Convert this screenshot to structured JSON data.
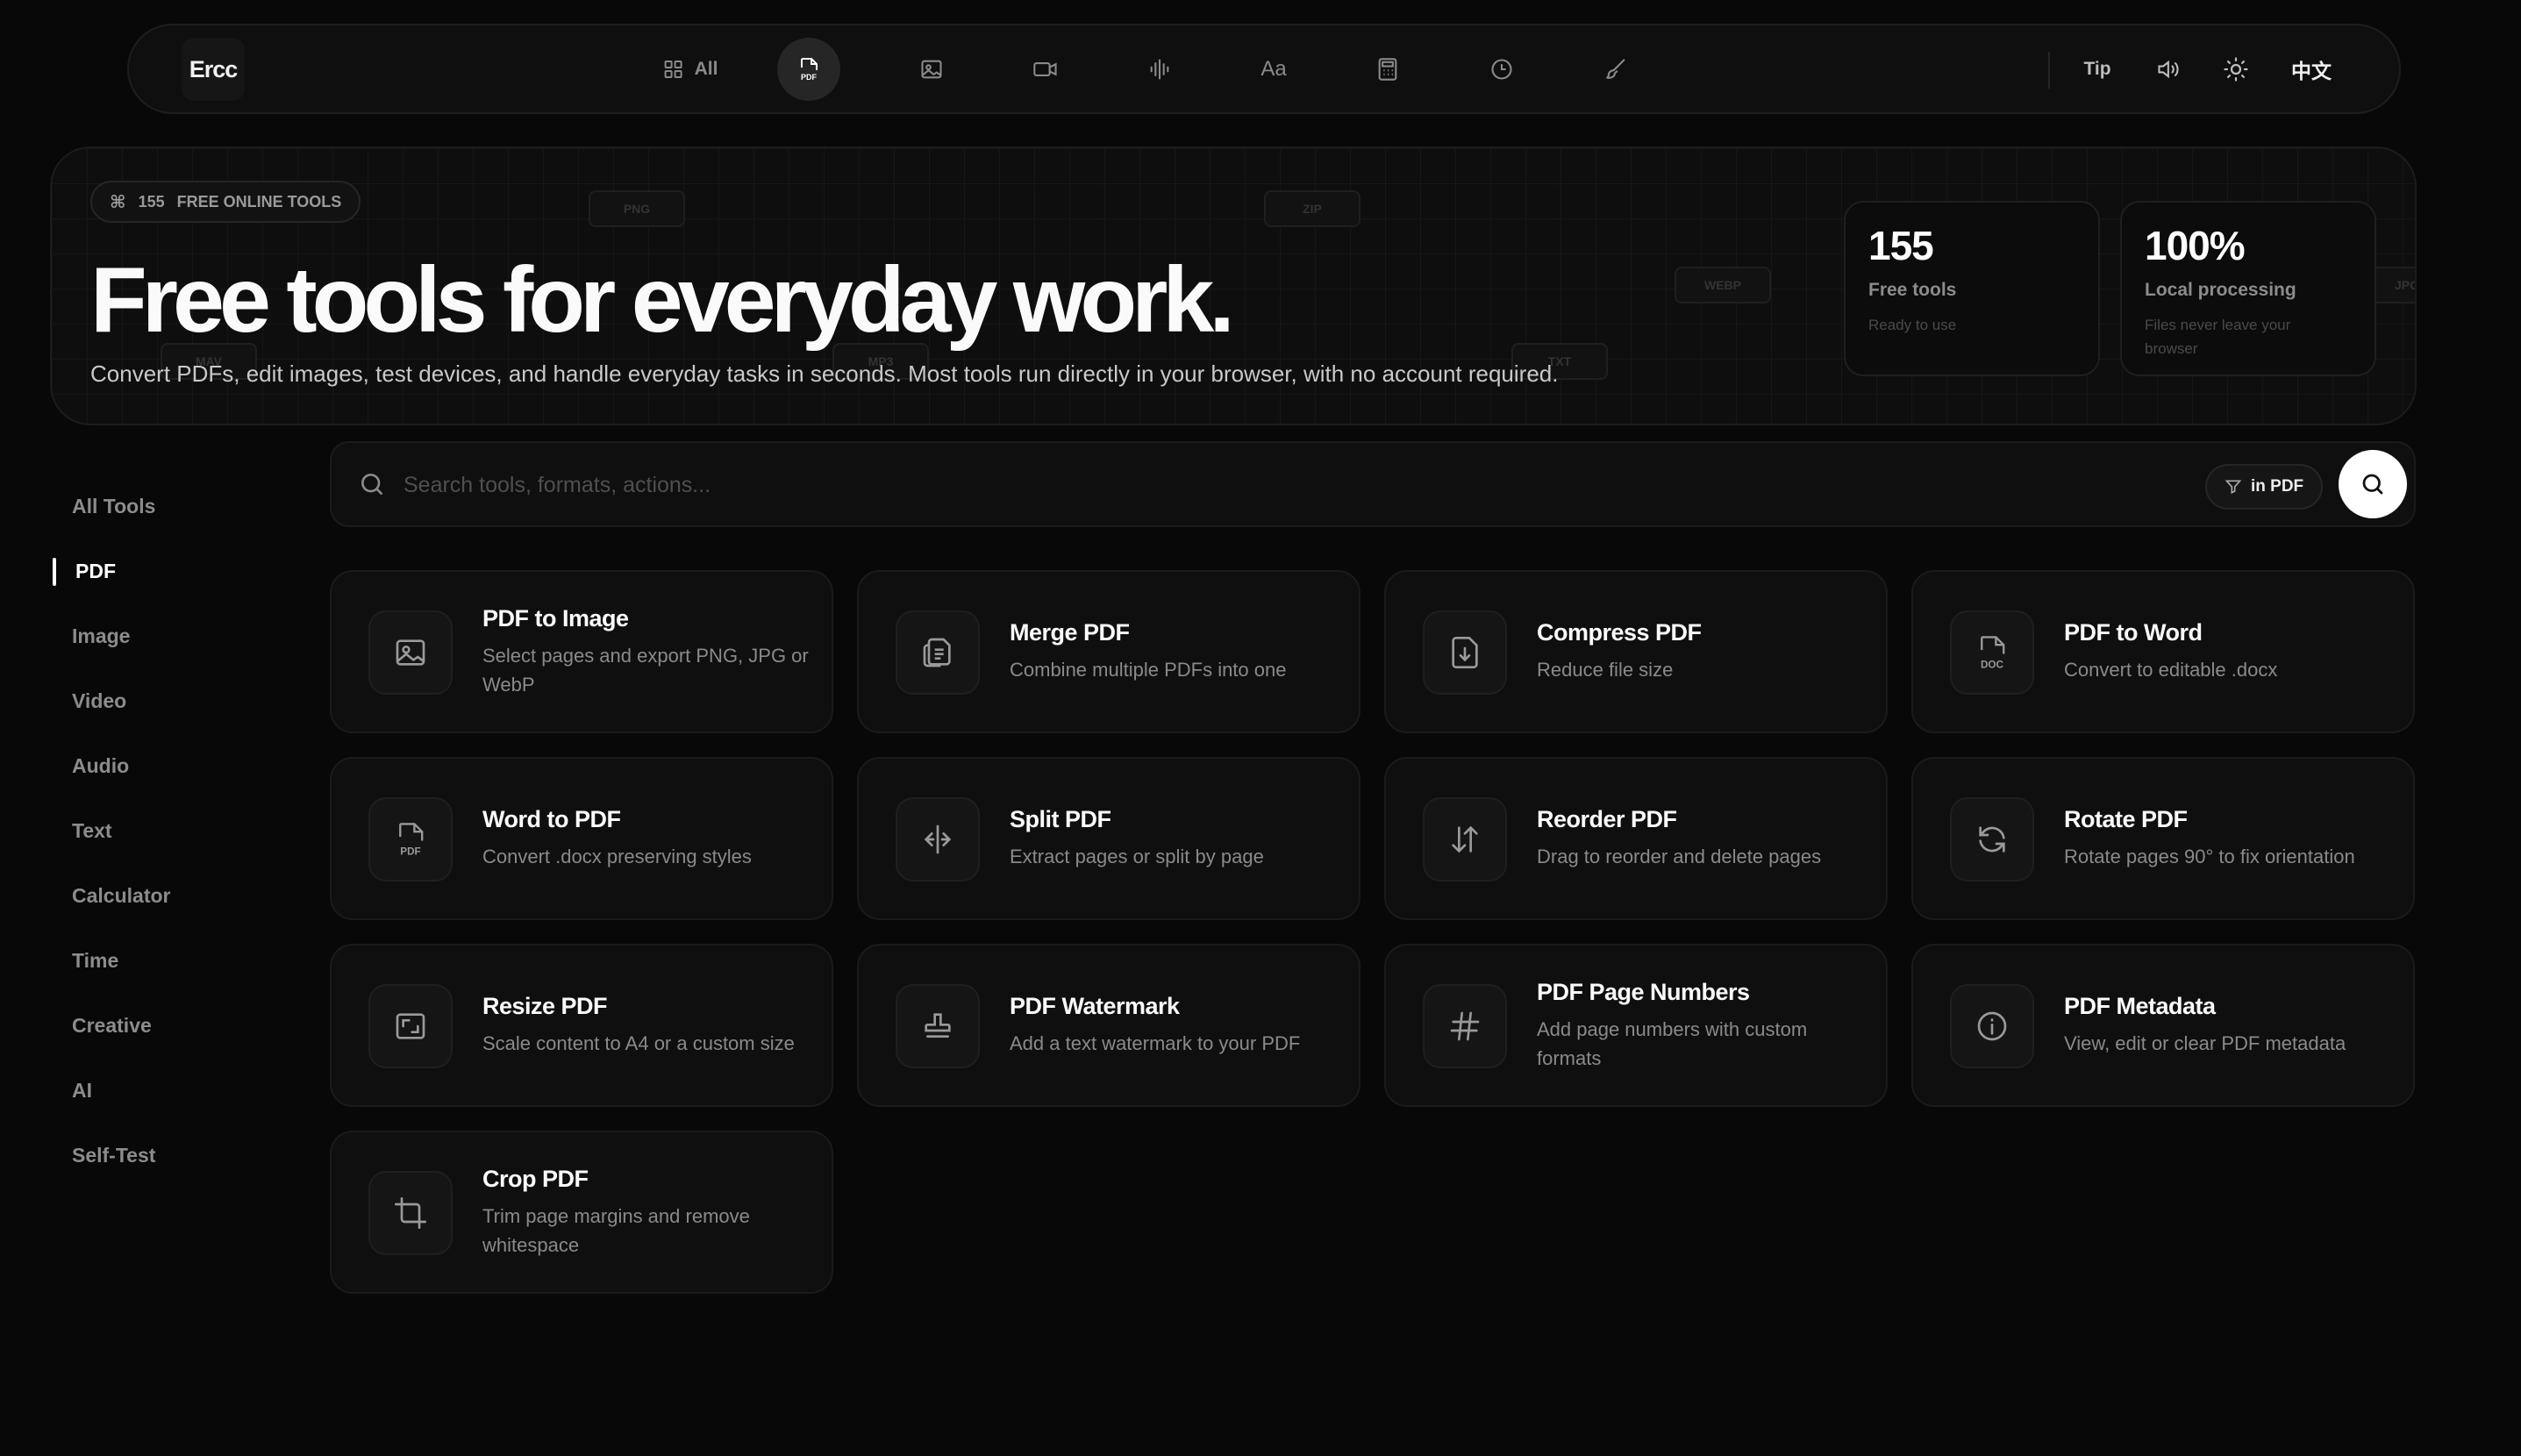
{
  "nav": {
    "brand": "Ercc",
    "all_label": "All",
    "pdf_icon_label": "PDF",
    "tip_label": "Tip",
    "lang_label": "中文"
  },
  "hero": {
    "badge_count": "155",
    "badge_label": "FREE ONLINE TOOLS",
    "title": "Free tools for everyday work.",
    "subtitle": "Convert PDFs, edit images, test devices, and handle everyday tasks in seconds. Most tools run directly in your browser, with no account required.",
    "ghost_chips": [
      "PNG",
      "ZIP",
      "WEBP",
      "JPG",
      "MAV",
      "MP3",
      "TXT"
    ],
    "stats": [
      {
        "value": "155",
        "label": "Free tools",
        "note": "Ready to use"
      },
      {
        "value": "100%",
        "label": "Local processing",
        "note": "Files never leave your browser"
      }
    ]
  },
  "sidebar": {
    "items": [
      {
        "label": "All Tools"
      },
      {
        "label": "PDF"
      },
      {
        "label": "Image"
      },
      {
        "label": "Video"
      },
      {
        "label": "Audio"
      },
      {
        "label": "Text"
      },
      {
        "label": "Calculator"
      },
      {
        "label": "Time"
      },
      {
        "label": "Creative"
      },
      {
        "label": "AI"
      },
      {
        "label": "Self-Test"
      }
    ],
    "active": "PDF"
  },
  "search": {
    "placeholder": "Search tools, formats, actions...",
    "value": "",
    "filter_label": "in PDF"
  },
  "tools": [
    {
      "title": "PDF to Image",
      "desc": "Select pages and export PNG, JPG or WebP",
      "icon": "image-icon"
    },
    {
      "title": "Merge PDF",
      "desc": "Combine multiple PDFs into one",
      "icon": "merge-files-icon"
    },
    {
      "title": "Compress PDF",
      "desc": "Reduce file size",
      "icon": "file-download-icon"
    },
    {
      "title": "PDF to Word",
      "desc": "Convert to editable .docx",
      "icon": "doc-file-icon",
      "icon_text": "DOC"
    },
    {
      "title": "Word to PDF",
      "desc": "Convert .docx preserving styles",
      "icon": "pdf-file-icon",
      "icon_text": "PDF"
    },
    {
      "title": "Split PDF",
      "desc": "Extract pages or split by page",
      "icon": "split-icon"
    },
    {
      "title": "Reorder PDF",
      "desc": "Drag to reorder and delete pages",
      "icon": "reorder-arrows-icon"
    },
    {
      "title": "Rotate PDF",
      "desc": "Rotate pages 90° to fix orientation",
      "icon": "rotate-icon"
    },
    {
      "title": "Resize PDF",
      "desc": "Scale content to A4 or a custom size",
      "icon": "resize-icon"
    },
    {
      "title": "PDF Watermark",
      "desc": "Add a text watermark to your PDF",
      "icon": "stamp-icon"
    },
    {
      "title": "PDF Page Numbers",
      "desc": "Add page numbers with custom formats",
      "icon": "hash-icon"
    },
    {
      "title": "PDF Metadata",
      "desc": "View, edit or clear PDF metadata",
      "icon": "info-icon"
    },
    {
      "title": "Crop PDF",
      "desc": "Trim page margins and remove whitespace",
      "icon": "crop-icon"
    }
  ],
  "colors": {
    "background": "#080808",
    "panel": "#0f0f0f",
    "text_primary": "#fafafa",
    "text_muted": "#8a8a8a"
  }
}
